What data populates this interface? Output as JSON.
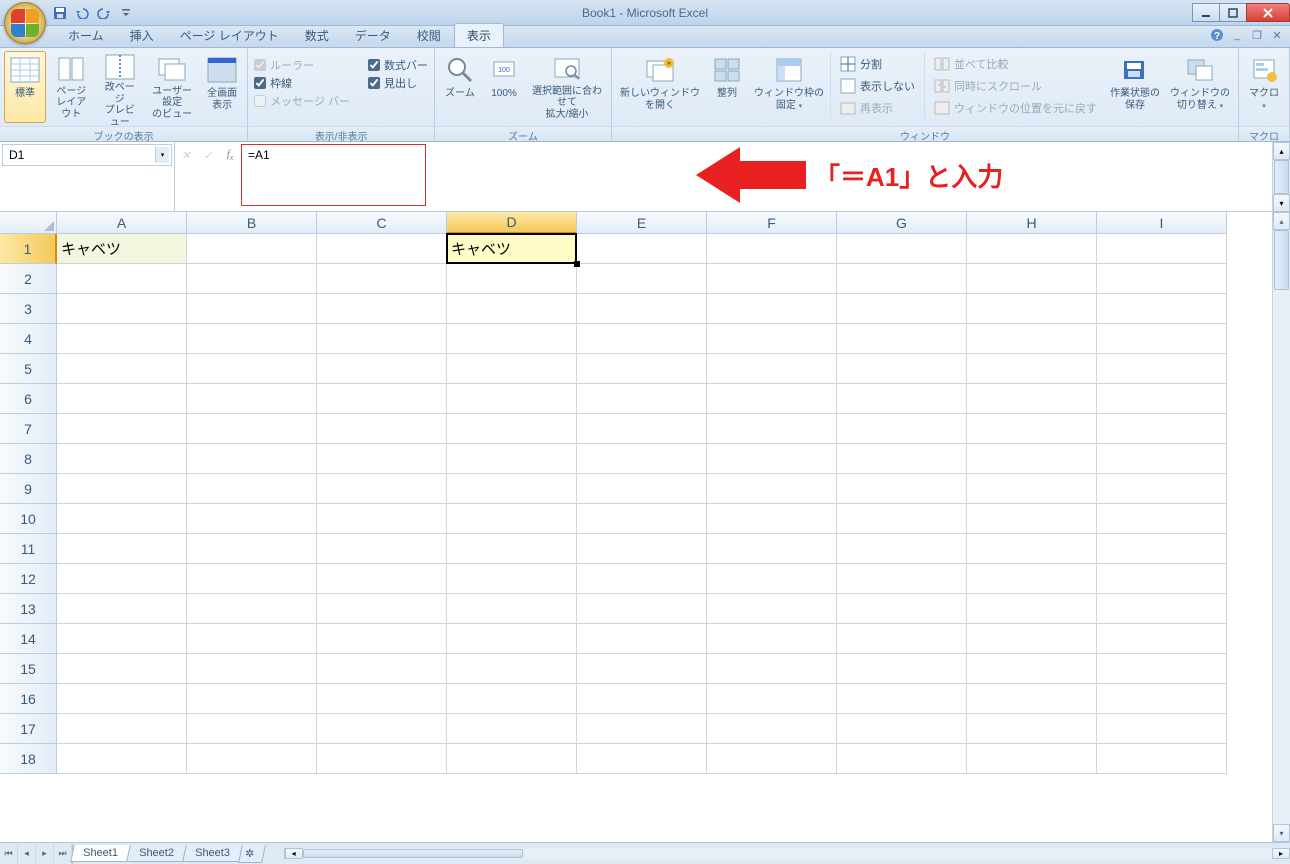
{
  "title": "Book1 - Microsoft Excel",
  "tabs": [
    "ホーム",
    "挿入",
    "ページ レイアウト",
    "数式",
    "データ",
    "校閲",
    "表示"
  ],
  "active_tab": "表示",
  "ribbon": {
    "group1": {
      "label": "ブックの表示",
      "btns": [
        "標準",
        "ページ\nレイアウト",
        "改ページ\nプレビュー",
        "ユーザー設定\nのビュー",
        "全画面\n表示"
      ]
    },
    "group2": {
      "label": "表示/非表示",
      "chk": [
        {
          "label": "ルーラー",
          "checked": true,
          "disabled": true
        },
        {
          "label": "枠線",
          "checked": true
        },
        {
          "label": "メッセージ バー",
          "checked": false,
          "disabled": true
        },
        {
          "label": "数式バー",
          "checked": true
        },
        {
          "label": "見出し",
          "checked": true
        }
      ]
    },
    "group3": {
      "label": "ズーム",
      "btns": [
        "ズーム",
        "100%",
        "選択範囲に合わせて\n拡大/縮小"
      ]
    },
    "group4": {
      "label": "ウィンドウ",
      "btns_l": [
        "新しいウィンドウ\nを開く",
        "整列",
        "ウィンドウ枠の\n固定"
      ],
      "rows": [
        {
          "label": "分割"
        },
        {
          "label": "表示しない"
        },
        {
          "label": "再表示",
          "disabled": true
        }
      ],
      "rows2": [
        {
          "label": "並べて比較",
          "disabled": true
        },
        {
          "label": "同時にスクロール",
          "disabled": true
        },
        {
          "label": "ウィンドウの位置を元に戻す",
          "disabled": true
        }
      ],
      "btns_r": [
        "作業状態の\n保存",
        "ウィンドウの\n切り替え"
      ]
    },
    "group5": {
      "label": "マクロ",
      "btn": "マクロ"
    }
  },
  "namebox": "D1",
  "formula": "=A1",
  "annotation": "「＝A1」と入力",
  "columns": [
    "A",
    "B",
    "C",
    "D",
    "E",
    "F",
    "G",
    "H",
    "I"
  ],
  "rows": [
    "1",
    "2",
    "3",
    "4",
    "5",
    "6",
    "7",
    "8",
    "9",
    "10",
    "11",
    "12",
    "13",
    "14",
    "15",
    "16",
    "17",
    "18"
  ],
  "selected_col": "D",
  "selected_row": "1",
  "cells": {
    "A1": "キャベツ",
    "D1": "キャベツ"
  },
  "sheets": [
    "Sheet1",
    "Sheet2",
    "Sheet3"
  ],
  "active_sheet": "Sheet1"
}
